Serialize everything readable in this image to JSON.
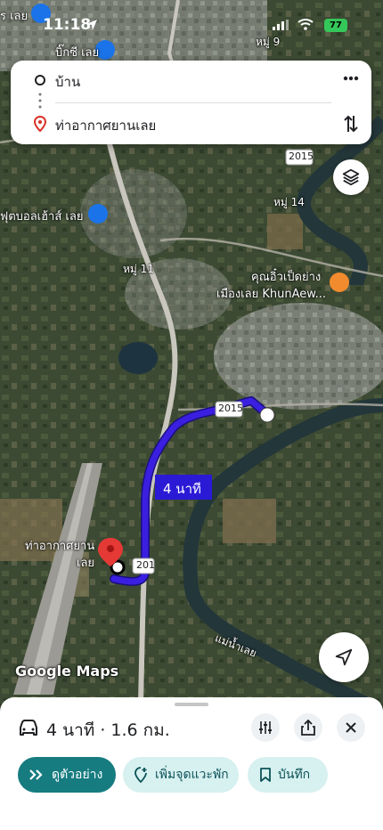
{
  "status_bar": {
    "time": "11:18",
    "battery": "77"
  },
  "map": {
    "labels": {
      "top_left": "ร เลย",
      "bigc": "บิ๊กซี เลย",
      "moo9": "หมู่ 9",
      "road2015_top": "2015",
      "moo14": "หมู่ 14",
      "football": "ฟุตบอลเฮ้าส์ เลย",
      "moo11": "หมู่ 11",
      "restaurant_line1": "คุณอิ๋วเป็ดย่าง",
      "restaurant_line2": "เมืองเลย KhunAew...",
      "road2015_route": "2015",
      "airport_line1": "ท่าอากาศยาน",
      "airport_line2": "เลย",
      "road201": "201",
      "river": "แม่น้ำเลย",
      "google_maps": "Google Maps"
    },
    "route_callout": "4 นาที",
    "colors": {
      "route": "#3b1fe0",
      "pin": "#e53935"
    }
  },
  "route_card": {
    "origin": "บ้าน",
    "destination": "ท่าอากาศยานเลย"
  },
  "bottom_sheet": {
    "summary": "4 นาที · 1.6 กม.",
    "preview_label": "ดูตัวอย่าง",
    "add_stop_label": "เพิ่มจุดแวะพัก",
    "save_label": "บันทึก",
    "accent": "#167c80"
  }
}
